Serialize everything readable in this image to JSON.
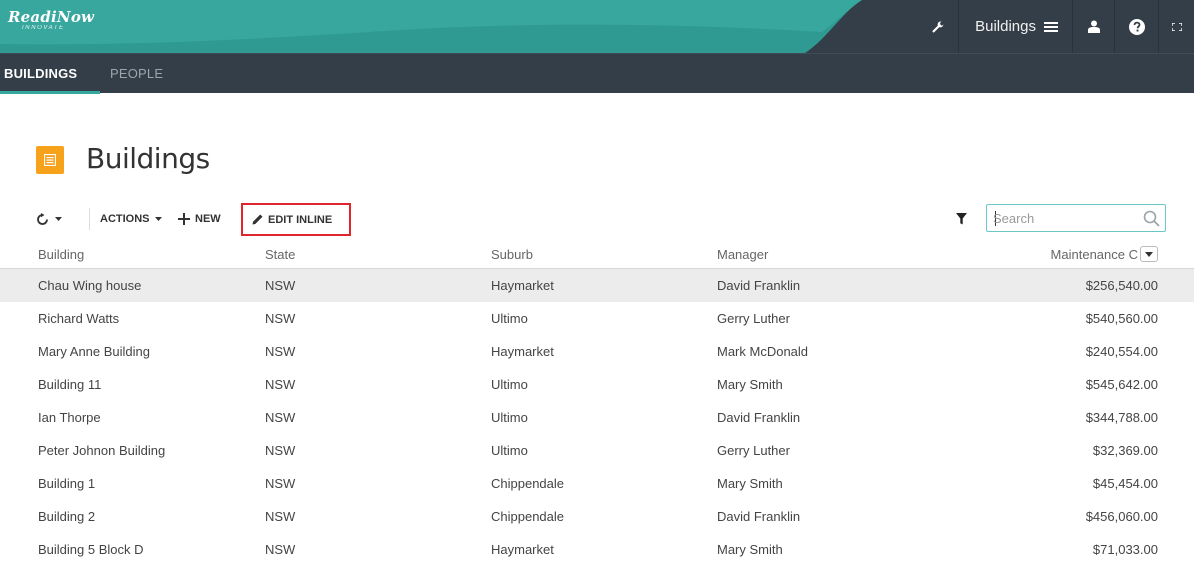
{
  "app": {
    "logo_main": "ReadiNow",
    "logo_sub": "INNOVATE",
    "nav_menu_label": "Buildings",
    "colors": {
      "header": "#333e48",
      "brand_teal": "#35a99e",
      "accent_orange": "#f7a21b",
      "highlight_red": "#e0262d"
    }
  },
  "tabs": [
    {
      "label": "BUILDINGS",
      "active": true
    },
    {
      "label": "PEOPLE",
      "active": false
    }
  ],
  "page": {
    "title": "Buildings"
  },
  "toolbar": {
    "actions_label": "ACTIONS",
    "new_label": "NEW",
    "edit_inline_label": "EDIT INLINE",
    "search_placeholder": "Search"
  },
  "grid": {
    "columns": [
      "Building",
      "State",
      "Suburb",
      "Manager",
      "Maintenance C"
    ],
    "rows": [
      {
        "building": "Chau Wing house",
        "state": "NSW",
        "suburb": "Haymarket",
        "manager": "David Franklin",
        "cost": "$256,540.00"
      },
      {
        "building": "Richard Watts",
        "state": "NSW",
        "suburb": "Ultimo",
        "manager": "Gerry Luther",
        "cost": "$540,560.00"
      },
      {
        "building": "Mary Anne Building",
        "state": "NSW",
        "suburb": "Haymarket",
        "manager": "Mark McDonald",
        "cost": "$240,554.00"
      },
      {
        "building": "Building 11",
        "state": "NSW",
        "suburb": "Ultimo",
        "manager": "Mary Smith",
        "cost": "$545,642.00"
      },
      {
        "building": "Ian Thorpe",
        "state": "NSW",
        "suburb": "Ultimo",
        "manager": "David Franklin",
        "cost": "$344,788.00"
      },
      {
        "building": "Peter Johnon Building",
        "state": "NSW",
        "suburb": "Ultimo",
        "manager": "Gerry Luther",
        "cost": "$32,369.00"
      },
      {
        "building": "Building 1",
        "state": "NSW",
        "suburb": "Chippendale",
        "manager": "Mary Smith",
        "cost": "$45,454.00"
      },
      {
        "building": "Building 2",
        "state": "NSW",
        "suburb": "Chippendale",
        "manager": "David Franklin",
        "cost": "$456,060.00"
      },
      {
        "building": "Building 5 Block D",
        "state": "NSW",
        "suburb": "Haymarket",
        "manager": "Mary Smith",
        "cost": "$71,033.00"
      }
    ]
  }
}
